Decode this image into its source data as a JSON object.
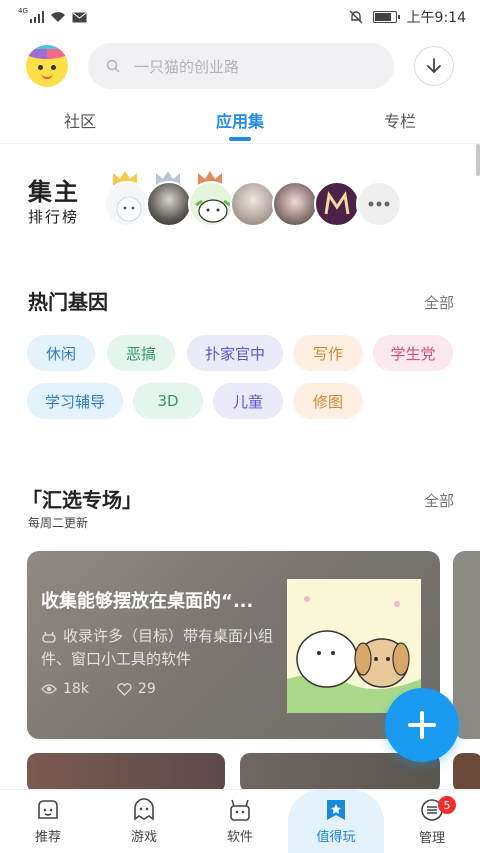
{
  "status_bar": {
    "network": "4G",
    "time": "上午9:14",
    "battery_level": 0.85
  },
  "header": {
    "search_placeholder": "一只猫的创业路"
  },
  "tabs": [
    {
      "label": "社区",
      "active": false
    },
    {
      "label": "应用集",
      "active": true
    },
    {
      "label": "专栏",
      "active": false
    }
  ],
  "ranking": {
    "title_big": "集主",
    "title_small": "排行榜"
  },
  "hot_tags": {
    "title": "热门基因",
    "all_label": "全部",
    "tags": [
      {
        "label": "休闲",
        "bg": "#e3f2fd",
        "color": "#2f7dc5"
      },
      {
        "label": "恶搞",
        "bg": "#e3f5ec",
        "color": "#2f9a63"
      },
      {
        "label": "扑家官中",
        "bg": "#ebeaf9",
        "color": "#5b57c6"
      },
      {
        "label": "写作",
        "bg": "#fdf0e3",
        "color": "#d7862b"
      },
      {
        "label": "学生党",
        "bg": "#fbe9ef",
        "color": "#d04f7d"
      },
      {
        "label": "学习辅导",
        "bg": "#e3f2fd",
        "color": "#2f7dc5"
      },
      {
        "label": "3D",
        "bg": "#e3f5ec",
        "color": "#2f9a63"
      },
      {
        "label": "儿童",
        "bg": "#ebeaf9",
        "color": "#5b57c6"
      },
      {
        "label": "修图",
        "bg": "#fdf0e3",
        "color": "#d7862b"
      }
    ]
  },
  "featured": {
    "title": "「汇选专场」",
    "all_label": "全部",
    "subtitle": "每周二更新",
    "card": {
      "title": "收集能够摆放在桌面的“...",
      "description": "收录许多（目标）带有桌面小组件、窗口小工具的软件",
      "views": "18k",
      "likes": "29"
    }
  },
  "bottom_nav": {
    "items": [
      {
        "label": "推荐"
      },
      {
        "label": "游戏"
      },
      {
        "label": "软件"
      },
      {
        "label": "值得玩"
      },
      {
        "label": "管理"
      }
    ],
    "badge": "5"
  },
  "colors": {
    "accent": "#1f8de6",
    "fab": "#1a9af0",
    "badge": "#ef2e2e"
  }
}
